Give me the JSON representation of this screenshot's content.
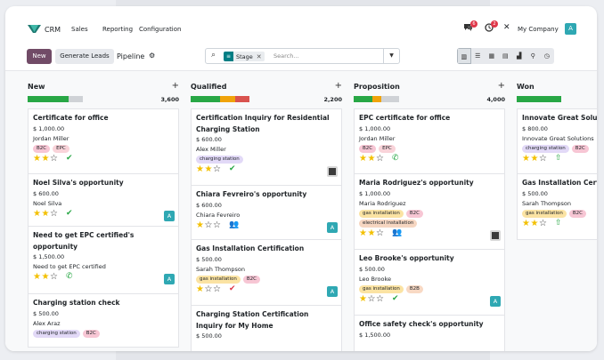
{
  "navbar": {
    "app_name": "CRM",
    "menus": [
      "Sales",
      "Reporting",
      "Configuration"
    ],
    "chat_badge": "6",
    "activity_badge": "2",
    "company": "My Company",
    "user_initial": "A"
  },
  "control": {
    "new_label": "New",
    "generate_label": "Generate Leads",
    "title": "Pipeline",
    "facet_label": "Stage",
    "search_placeholder": "Search..."
  },
  "columns": [
    {
      "name": "New",
      "total": "3,600",
      "bar": [
        {
          "color": "#28a745",
          "w": 0.55
        },
        {
          "color": "#cfd2d6",
          "w": 0.2
        }
      ],
      "cards": [
        {
          "title": "Certificate for office",
          "amount": "$ 1,000.00",
          "contact": "Jordan Miller",
          "tags": [
            {
              "t": "B2C",
              "c": "#f7c6d4"
            },
            {
              "t": "EPC",
              "c": "#f9d3d9"
            }
          ],
          "stars": 2,
          "act": "check",
          "avatar": null,
          "h": 74
        },
        {
          "title": "Noel Silva's opportunity",
          "amount": "$ 600.00",
          "contact": "Noel Silva",
          "tags": [],
          "stars": 2,
          "act": "check",
          "avatar": "A",
          "h": 59
        },
        {
          "title": "Need to get EPC certified's opportunity",
          "amount": "$ 1,500.00",
          "contact": "Need to get EPC certified",
          "tags": [],
          "stars": 2,
          "act": "phone",
          "avatar": "A",
          "h": 76
        },
        {
          "title": "Charging station check",
          "amount": "$ 500.00",
          "contact": "Alex Araz",
          "tags": [
            {
              "t": "charging station",
              "c": "#e2d9f7"
            },
            {
              "t": "B2C",
              "c": "#f7c6d4"
            }
          ],
          "stars": 0,
          "act": null,
          "avatar": null,
          "h": 60
        }
      ]
    },
    {
      "name": "Qualified",
      "total": "2,200",
      "bar": [
        {
          "color": "#28a745",
          "w": 0.4
        },
        {
          "color": "#f0a30a",
          "w": 0.2
        },
        {
          "color": "#d9534f",
          "w": 0.2
        }
      ],
      "cards": [
        {
          "title": "Certification Inquiry for Residential Charging Station",
          "amount": "$ 600.00",
          "contact": "Alex Miller",
          "tags": [
            {
              "t": "charging station",
              "c": "#e2d9f7"
            }
          ],
          "stars": 2,
          "act": "check",
          "avatar": "img",
          "h": 87
        },
        {
          "title": "Chiara Fevreiro's opportunity",
          "amount": "$ 600.00",
          "contact": "Chiara Fevreiro",
          "tags": [],
          "stars": 1,
          "act": "meeting",
          "avatar": "A",
          "h": 61
        },
        {
          "title": "Gas Installation Certification",
          "amount": "$ 500.00",
          "contact": "Sarah Thompson",
          "tags": [
            {
              "t": "gas installation",
              "c": "#fbe3a3"
            },
            {
              "t": "B2C",
              "c": "#f7c6d4"
            }
          ],
          "stars": 1,
          "act": "check-red",
          "avatar": "A",
          "h": 74
        },
        {
          "title": "Charging Station Certification Inquiry for My Home",
          "amount": "$ 500.00",
          "contact": "",
          "tags": [],
          "stars": 0,
          "act": null,
          "avatar": null,
          "h": 60
        }
      ]
    },
    {
      "name": "Proposition",
      "total": "4,000",
      "bar": [
        {
          "color": "#28a745",
          "w": 0.25
        },
        {
          "color": "#f0a30a",
          "w": 0.12
        },
        {
          "color": "#cfd2d6",
          "w": 0.25
        }
      ],
      "cards": [
        {
          "title": "EPC certificate for office",
          "amount": "$ 1,000.00",
          "contact": "Jordan Miller",
          "tags": [
            {
              "t": "B2C",
              "c": "#f7c6d4"
            },
            {
              "t": "EPC",
              "c": "#f9d3d9"
            }
          ],
          "stars": 2,
          "act": "phone",
          "avatar": null,
          "h": 74
        },
        {
          "title": "Maria Rodriguez's opportunity",
          "amount": "$ 1,000.00",
          "contact": "Maria Rodriguez",
          "tags": [
            {
              "t": "gas installation",
              "c": "#fbe3a3"
            },
            {
              "t": "B2C",
              "c": "#f7c6d4"
            }
          ],
          "tags2": [
            {
              "t": "electrical installation",
              "c": "#f6d6c1"
            }
          ],
          "stars": 2,
          "act": "meeting",
          "avatar": "img",
          "h": 85
        },
        {
          "title": "Leo Brooke's opportunity",
          "amount": "$ 500.00",
          "contact": "Leo Brooke",
          "tags": [
            {
              "t": "gas installation",
              "c": "#fbe3a3"
            },
            {
              "t": "B2B",
              "c": "#f8d9c4"
            }
          ],
          "stars": 1,
          "act": "check",
          "avatar": "A",
          "h": 74
        },
        {
          "title": "Office safety check's opportunity",
          "amount": "$ 1,500.00",
          "contact": "",
          "tags": [],
          "stars": 0,
          "act": null,
          "avatar": null,
          "h": 60
        }
      ]
    },
    {
      "name": "Won",
      "total": "",
      "bar": [
        {
          "color": "#28a745",
          "w": 0.6
        }
      ],
      "cards": [
        {
          "title": "Innovate Great Solutions",
          "amount": "$ 800.00",
          "contact": "Innovate Great Solutions",
          "tags": [
            {
              "t": "charging station",
              "c": "#e2d9f7"
            },
            {
              "t": "B2C",
              "c": "#f7c6d4"
            }
          ],
          "stars": 2,
          "act": "person",
          "avatar": null,
          "h": 74
        },
        {
          "title": "Gas Installation Certification",
          "amount": "$ 500.00",
          "contact": "Sarah Thompson",
          "tags": [
            {
              "t": "gas installation",
              "c": "#fbe3a3"
            },
            {
              "t": "B2C",
              "c": "#f7c6d4"
            }
          ],
          "stars": 2,
          "act": "person",
          "avatar": null,
          "h": 74
        }
      ]
    }
  ]
}
